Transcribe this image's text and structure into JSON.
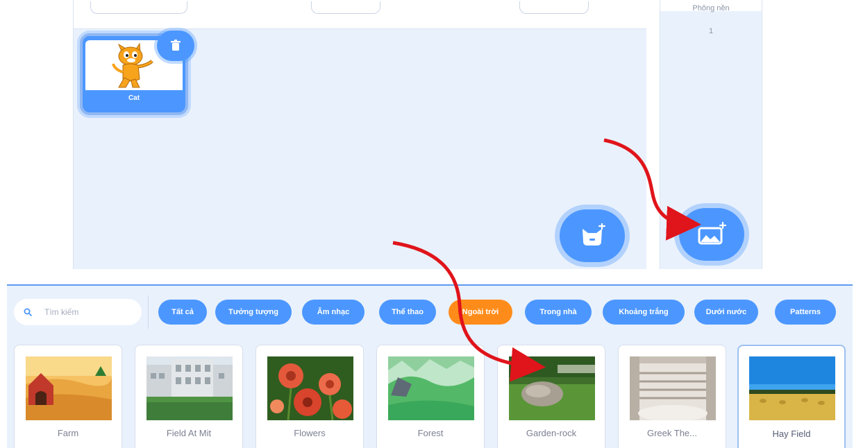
{
  "stage_panel": {
    "hint": "Phông nền",
    "count": "1"
  },
  "sprite": {
    "name": "Cat"
  },
  "library": {
    "search_placeholder": "Tìm kiếm",
    "categories": [
      {
        "label": "Tất cả"
      },
      {
        "label": "Tưởng tượng"
      },
      {
        "label": "Âm nhạc"
      },
      {
        "label": "Thể thao"
      },
      {
        "label": "Ngoài trời",
        "active": true
      },
      {
        "label": "Trong nhà"
      },
      {
        "label": "Khoảng trắng"
      },
      {
        "label": "Dưới nước"
      },
      {
        "label": "Patterns"
      }
    ],
    "backdrops": [
      {
        "name": "Farm"
      },
      {
        "name": "Field At Mit"
      },
      {
        "name": "Flowers"
      },
      {
        "name": "Forest"
      },
      {
        "name": "Garden-rock"
      },
      {
        "name": "Greek The..."
      },
      {
        "name": "Hay Field",
        "selected": true
      }
    ]
  },
  "colors": {
    "accent": "#4c97ff",
    "active_category": "#ff8c1a",
    "arrow": "#e0141b",
    "pane_background": "#e9f1fc"
  },
  "icons": [
    "search-icon",
    "trash-icon",
    "choose-sprite-icon",
    "choose-backdrop-icon"
  ]
}
